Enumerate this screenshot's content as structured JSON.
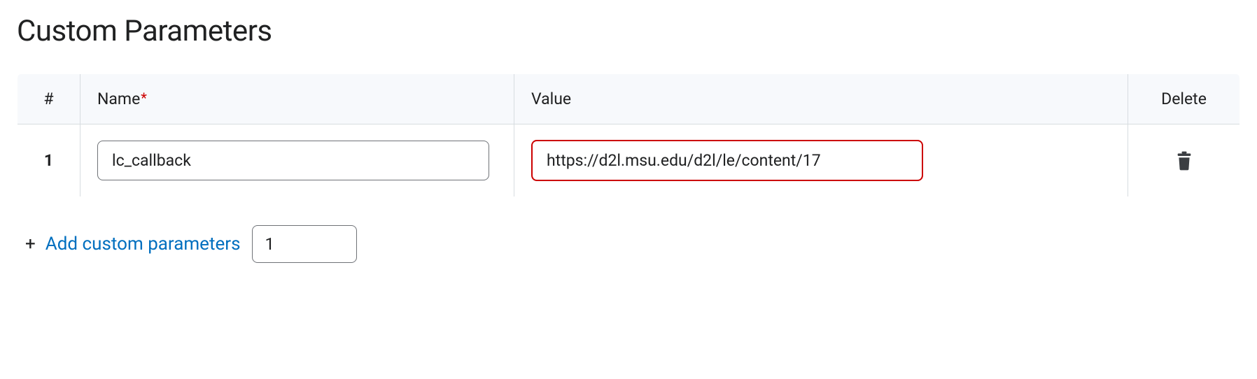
{
  "title": "Custom Parameters",
  "table": {
    "headers": {
      "index": "#",
      "name": "Name",
      "name_required": "*",
      "value": "Value",
      "delete": "Delete"
    },
    "rows": [
      {
        "index": "1",
        "name": "lc_callback",
        "value": "https://d2l.msu.edu/d2l/le/content/17",
        "value_invalid": true
      }
    ]
  },
  "add": {
    "label": "Add custom parameters",
    "count": "1"
  }
}
